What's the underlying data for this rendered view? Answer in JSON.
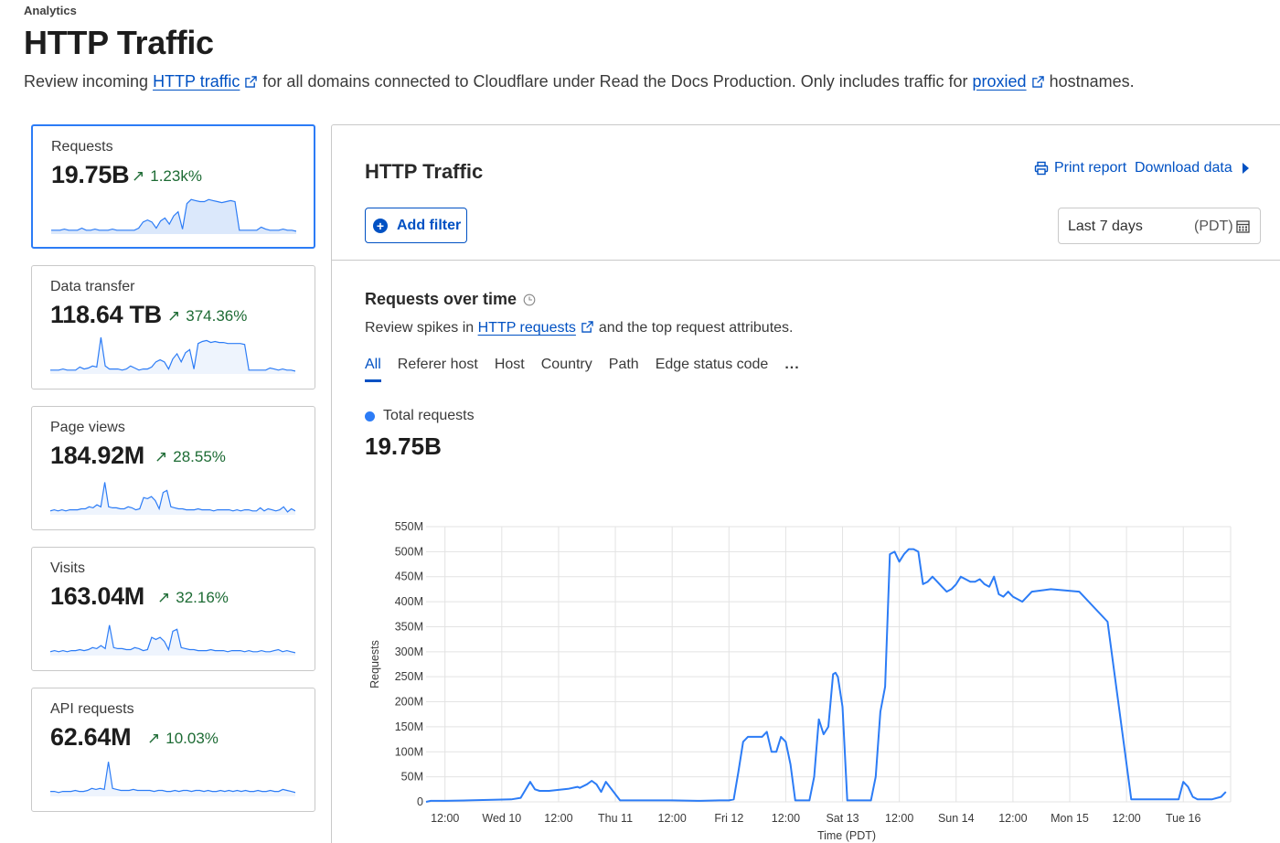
{
  "header": {
    "eyebrow": "Analytics",
    "title": "HTTP Traffic",
    "desc_1": "Review incoming ",
    "desc_link_1": "HTTP traffic",
    "desc_2": "for all domains connected to Cloudflare under Read the Docs Production. Only includes traffic for ",
    "desc_link_2": "proxied",
    "desc_3": "hostnames."
  },
  "cards": [
    {
      "label": "Requests",
      "value": "19.75B",
      "change": "1.23k%",
      "active": true,
      "spark": [
        2,
        2,
        2,
        3,
        2,
        2,
        2,
        4,
        2,
        2,
        3,
        2,
        2,
        2,
        3,
        2,
        2,
        2,
        2,
        2,
        4,
        10,
        12,
        10,
        4,
        11,
        14,
        8,
        16,
        20,
        3,
        28,
        32,
        31,
        30,
        30,
        32,
        31,
        30,
        29,
        30,
        31,
        30,
        2,
        2,
        2,
        2,
        2,
        5,
        3,
        2,
        2,
        2,
        3,
        2,
        2,
        1
      ]
    },
    {
      "label": "Data transfer",
      "value": "118.64 TB",
      "change": "374.36%",
      "active": false,
      "spark": [
        2,
        2,
        2,
        3,
        2,
        2,
        2,
        5,
        3,
        4,
        6,
        5,
        34,
        6,
        3,
        3,
        3,
        2,
        3,
        6,
        4,
        2,
        3,
        3,
        5,
        10,
        12,
        10,
        3,
        13,
        18,
        10,
        19,
        22,
        3,
        28,
        30,
        31,
        29,
        30,
        29,
        29,
        28,
        28,
        28,
        28,
        27,
        2,
        2,
        2,
        2,
        2,
        4,
        3,
        2,
        3,
        2,
        2,
        1
      ]
    },
    {
      "label": "Page views",
      "value": "184.92M",
      "change": "28.55%",
      "active": false,
      "spark": [
        2,
        3,
        2,
        3,
        2,
        3,
        3,
        3,
        4,
        4,
        6,
        5,
        8,
        6,
        30,
        6,
        5,
        5,
        4,
        4,
        6,
        5,
        3,
        4,
        15,
        14,
        16,
        12,
        4,
        20,
        22,
        6,
        5,
        4,
        4,
        3,
        3,
        3,
        4,
        3,
        3,
        3,
        2,
        3,
        3,
        3,
        3,
        2,
        3,
        2,
        3,
        3,
        2,
        2,
        5,
        2,
        4,
        3,
        2,
        3,
        6,
        1,
        4,
        2
      ]
    },
    {
      "label": "Visits",
      "value": "163.04M",
      "change": "32.16%",
      "active": false,
      "spark": [
        2,
        3,
        2,
        3,
        2,
        3,
        3,
        4,
        3,
        4,
        6,
        5,
        8,
        5,
        28,
        6,
        5,
        5,
        4,
        4,
        6,
        5,
        3,
        4,
        16,
        14,
        16,
        12,
        4,
        22,
        24,
        6,
        5,
        4,
        4,
        3,
        3,
        3,
        4,
        3,
        3,
        3,
        2,
        3,
        3,
        3,
        2,
        3,
        2,
        2,
        3,
        2,
        2,
        3,
        4,
        2,
        3,
        2,
        1
      ]
    },
    {
      "label": "API requests",
      "value": "62.64M",
      "change": "10.03%",
      "active": false,
      "spark": [
        3,
        3,
        2,
        3,
        3,
        3,
        4,
        3,
        3,
        4,
        6,
        5,
        6,
        5,
        32,
        6,
        5,
        4,
        4,
        4,
        5,
        4,
        4,
        4,
        4,
        3,
        4,
        4,
        3,
        3,
        4,
        3,
        4,
        4,
        3,
        4,
        4,
        3,
        4,
        3,
        3,
        4,
        3,
        4,
        3,
        4,
        3,
        4,
        3,
        3,
        4,
        3,
        3,
        4,
        3,
        3,
        5,
        4,
        3,
        2
      ]
    }
  ],
  "panel": {
    "title": "HTTP Traffic",
    "print_label": "Print report",
    "download_label": "Download data",
    "add_filter_label": "Add filter",
    "range_label": "Last 7 days",
    "range_tz": "(PDT)"
  },
  "section": {
    "title": "Requests over time",
    "desc_1": "Review spikes in ",
    "desc_link": "HTTP requests",
    "desc_2": "and the top request attributes.",
    "tabs": [
      "All",
      "Referer host",
      "Host",
      "Country",
      "Path",
      "Edge status code",
      "..."
    ],
    "legend_label": "Total requests",
    "total_value": "19.75B"
  },
  "colors": {
    "accent": "#0051c3",
    "series": "#2c7cf6",
    "positive": "#1d6b34"
  },
  "chart_data": {
    "type": "line",
    "xlabel": "Time (PDT)",
    "ylabel": "Requests",
    "x_ticks": [
      "12:00",
      "Wed 10",
      "12:00",
      "Thu 11",
      "12:00",
      "Fri 12",
      "12:00",
      "Sat 13",
      "12:00",
      "Sun 14",
      "12:00",
      "Mon 15",
      "12:00",
      "Tue 16"
    ],
    "y_ticks": [
      "0",
      "50M",
      "100M",
      "150M",
      "200M",
      "250M",
      "300M",
      "350M",
      "400M",
      "450M",
      "500M",
      "550M"
    ],
    "ylim": [
      0,
      550
    ],
    "y_unit": "M",
    "x_range_hours": [
      -4,
      166
    ],
    "grid": true,
    "series": [
      {
        "name": "Total requests",
        "hours": [
          -4,
          -3,
          0,
          5,
          10,
          14,
          16,
          18,
          19,
          20,
          22,
          24,
          26,
          28,
          28.5,
          30,
          31,
          32,
          33,
          34,
          37,
          42,
          48,
          54,
          58,
          60,
          61,
          62,
          63,
          64,
          65,
          66,
          67,
          68,
          69,
          70,
          71,
          72,
          73,
          74,
          75,
          76,
          77,
          78,
          79,
          80,
          81,
          82,
          82.5,
          83,
          84,
          85,
          87,
          88,
          89,
          90,
          91,
          92,
          93,
          94,
          95,
          96,
          97,
          98,
          99,
          100,
          101,
          102,
          103,
          104,
          105,
          106,
          107,
          108,
          109,
          110,
          111,
          112,
          113,
          114,
          115,
          116,
          117,
          118,
          119,
          119.5,
          120,
          121,
          122,
          124,
          128,
          134,
          140,
          145,
          150,
          151,
          152,
          153,
          154,
          155,
          156,
          157,
          158,
          159,
          160,
          162,
          164,
          165
        ],
        "values": [
          0,
          2,
          2,
          3,
          4,
          5,
          8,
          40,
          25,
          22,
          22,
          24,
          26,
          30,
          28,
          35,
          42,
          35,
          20,
          40,
          3,
          3,
          3,
          2,
          3,
          3,
          5,
          60,
          120,
          130,
          130,
          130,
          130,
          140,
          100,
          100,
          130,
          120,
          75,
          3,
          3,
          3,
          3,
          50,
          165,
          135,
          150,
          255,
          258,
          250,
          190,
          3,
          3,
          3,
          3,
          3,
          50,
          180,
          230,
          495,
          500,
          480,
          495,
          505,
          505,
          500,
          435,
          440,
          450,
          440,
          430,
          420,
          425,
          435,
          450,
          445,
          440,
          440,
          445,
          435,
          430,
          450,
          415,
          410,
          420,
          415,
          410,
          405,
          400,
          420,
          425,
          420,
          360,
          5,
          5,
          5,
          5,
          5,
          5,
          5,
          40,
          30,
          10,
          5,
          5,
          5,
          10,
          20,
          5,
          5,
          5,
          5,
          5,
          4,
          2
        ]
      }
    ]
  }
}
